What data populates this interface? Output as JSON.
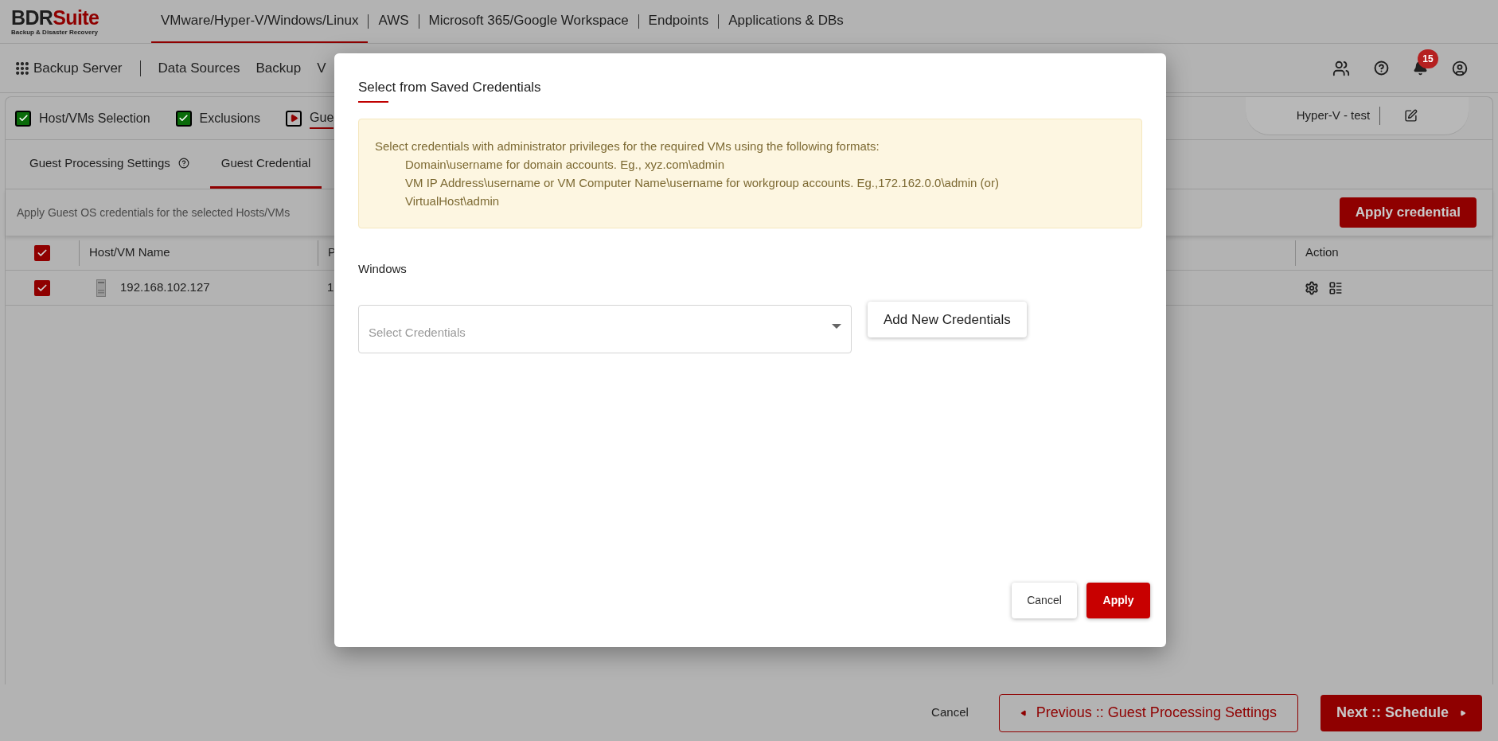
{
  "header": {
    "logo": {
      "brand": "BDR",
      "accent": "Suite",
      "tagline": "Backup & Disaster Recovery"
    },
    "nav": [
      {
        "label": "VMware/Hyper-V/Windows/Linux",
        "selected": true
      },
      {
        "label": "AWS",
        "selected": false
      },
      {
        "label": "Microsoft 365/Google Workspace",
        "selected": false
      },
      {
        "label": "Endpoints",
        "selected": false
      },
      {
        "label": "Applications & DBs",
        "selected": false
      }
    ]
  },
  "toolbar": {
    "app": "Backup Server",
    "links": [
      "Data Sources",
      "Backup",
      "V"
    ],
    "notification_count": "15"
  },
  "steps": [
    {
      "label": "Host/VMs Selection",
      "kind": "done"
    },
    {
      "label": "Exclusions",
      "kind": "done"
    },
    {
      "label": "Gue",
      "kind": "current"
    }
  ],
  "job_name": "Hyper-V - test",
  "subtabs": [
    {
      "label": "Guest Processing Settings",
      "help": true,
      "selected": false
    },
    {
      "label": "Guest Credential",
      "help": false,
      "selected": true
    }
  ],
  "instruction": "Apply Guest OS credentials for the selected Hosts/VMs",
  "apply_button": "Apply credential",
  "table": {
    "all_checked": true,
    "columns": [
      "Host/VM Name",
      "P",
      "Action"
    ],
    "rows": [
      {
        "checked": true,
        "name": "192.168.102.127",
        "column_2": "1"
      }
    ]
  },
  "modal": {
    "title": "Select from Saved Credentials",
    "info": {
      "intro": "Select credentials with administrator privileges for the required VMs using the following formats:",
      "lines": [
        "Domain\\username for domain accounts. Eg., xyz.com\\admin",
        "VM IP Address\\username or VM Computer Name\\username for workgroup accounts. Eg.,172.162.0.0\\admin (or)",
        "VirtualHost\\admin"
      ]
    },
    "section": "Windows",
    "select": {
      "placeholder": "Select Credentials"
    },
    "add_button": "Add New Credentials",
    "cancel": "Cancel",
    "apply": "Apply"
  },
  "footer": {
    "cancel": "Cancel",
    "previous": "Previous :: Guest Processing Settings",
    "next": "Next :: Schedule"
  }
}
